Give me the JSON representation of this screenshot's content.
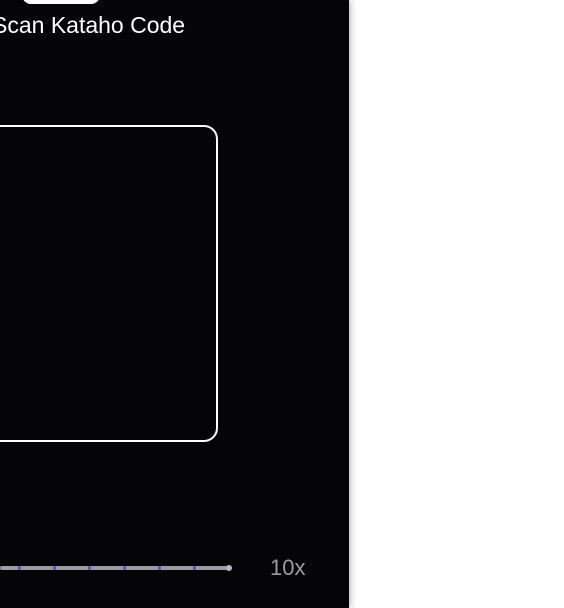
{
  "scanner": {
    "title": "Scan Kataho Code",
    "zoom_max_label": "10x",
    "zoom_level": 0
  },
  "colors": {
    "background": "#050407",
    "frame": "#ffffff",
    "slider_track": "#9b9aa3",
    "slider_ticks": "#5a5bb0"
  }
}
